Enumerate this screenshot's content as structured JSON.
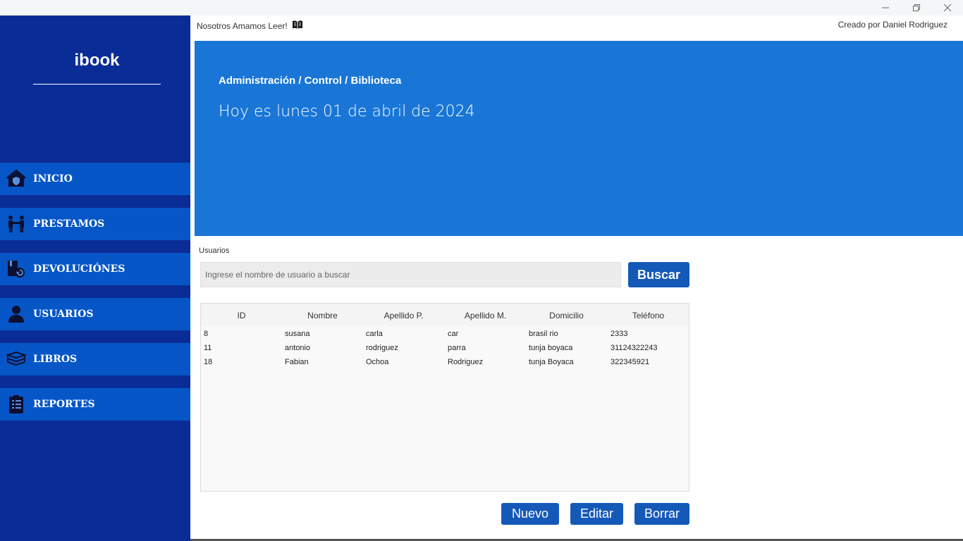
{
  "window": {
    "controls": [
      "minimize-icon",
      "restore-icon",
      "close-icon"
    ]
  },
  "sidebar": {
    "brand": "ibook",
    "items": [
      {
        "label": "INICIO",
        "icon": "home-shield-icon"
      },
      {
        "label": "PRESTAMOS",
        "icon": "handshake-people-icon"
      },
      {
        "label": "DEVOLUCIÓNES",
        "icon": "book-return-icon"
      },
      {
        "label": "USUARIOS",
        "icon": "user-icon"
      },
      {
        "label": "LIBROS",
        "icon": "books-stack-icon"
      },
      {
        "label": "REPORTES",
        "icon": "clipboard-list-icon"
      }
    ]
  },
  "header": {
    "slogan": "Nosotros Amamos Leer!",
    "slogan_icon": "open-book-icon",
    "credit": "Creado por Daniel Rodriguez"
  },
  "banner": {
    "breadcrumb": "Administración / Control / Biblioteca",
    "date": "Hoy es lunes 01 de abril de 2024"
  },
  "users": {
    "section_label": "Usuarios",
    "search_placeholder": "Ingrese el nombre de usuario a buscar",
    "search_value": "",
    "search_button": "Buscar",
    "columns": [
      "ID",
      "Nombre",
      "Apellido P.",
      "Apellido M.",
      "Domicilio",
      "Teléfono"
    ],
    "rows": [
      [
        "8",
        "susana",
        "carla",
        "car",
        "brasil rio",
        "2333"
      ],
      [
        "11",
        "antonio",
        "rodriguez",
        "parra",
        "tunja boyaca",
        "31124322243"
      ],
      [
        "18",
        "Fabian",
        "Ochoa",
        "Rodriguez",
        "tunja Boyaca",
        "322345921"
      ]
    ],
    "actions": {
      "new": "Nuevo",
      "edit": "Editar",
      "delete": "Borrar"
    }
  },
  "colors": {
    "sidebar_bg": "#0a2c96",
    "nav_item_bg": "#0656c7",
    "banner_bg": "#1976d6",
    "button_bg": "#1559b8"
  }
}
